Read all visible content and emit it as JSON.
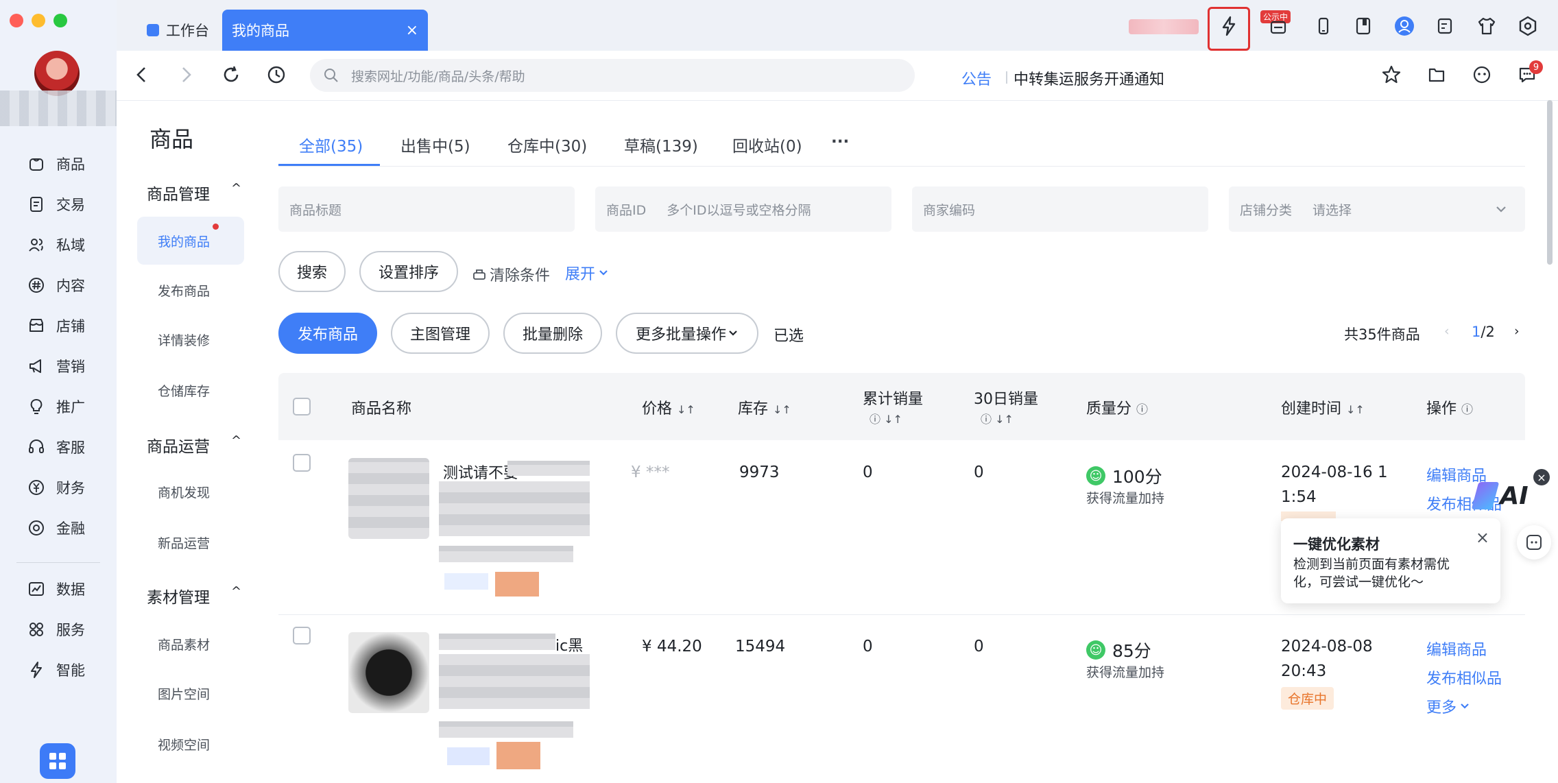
{
  "window": {
    "tabs": [
      {
        "label": "工作台",
        "active": false
      },
      {
        "label": "我的商品",
        "active": true,
        "close": "×"
      }
    ],
    "badge_gongshi": "公示中"
  },
  "toolbar": {
    "search_placeholder": "搜索网址/功能/商品/头条/帮助",
    "notice_tag": "公告",
    "notice_text": "中转集运服务开通通知",
    "message_count": "9"
  },
  "nav": [
    {
      "label": "商品",
      "icon": "product-icon"
    },
    {
      "label": "交易",
      "icon": "order-icon"
    },
    {
      "label": "私域",
      "icon": "users-icon"
    },
    {
      "label": "内容",
      "icon": "hashtag-icon"
    },
    {
      "label": "店铺",
      "icon": "store-icon"
    },
    {
      "label": "营销",
      "icon": "megaphone-icon"
    },
    {
      "label": "推广",
      "icon": "bulb-icon"
    },
    {
      "label": "客服",
      "icon": "headset-icon"
    },
    {
      "label": "财务",
      "icon": "yen-icon"
    },
    {
      "label": "金融",
      "icon": "finance-icon"
    },
    {
      "label": "数据",
      "icon": "chart-icon"
    },
    {
      "label": "服务",
      "icon": "grid-icon"
    },
    {
      "label": "智能",
      "icon": "lightning-icon"
    }
  ],
  "subnav": {
    "title": "商品",
    "groups": [
      {
        "label": "商品管理",
        "items": [
          "我的商品",
          "发布商品",
          "详情装修",
          "仓储库存"
        ]
      },
      {
        "label": "商品运营",
        "items": [
          "商机发现",
          "新品运营"
        ]
      },
      {
        "label": "素材管理",
        "items": [
          "商品素材",
          "图片空间",
          "视频空间"
        ]
      }
    ],
    "caret": "^"
  },
  "product_tabs": [
    "全部(35)",
    "出售中(5)",
    "仓库中(30)",
    "草稿(139)",
    "回收站(0)",
    "···"
  ],
  "filters": {
    "title_ph": "商品标题",
    "id_label": "商品ID",
    "id_ph": "多个ID以逗号或空格分隔",
    "code_ph": "商家编码",
    "cat_label": "店铺分类",
    "cat_ph": "请选择"
  },
  "actions": {
    "search": "搜索",
    "sort": "设置排序",
    "clear": "清除条件",
    "expand": "展开",
    "publish": "发布商品",
    "main_img": "主图管理",
    "batch_delete": "批量删除",
    "more_batch": "更多批量操作",
    "selected": "已选",
    "total": "共35件商品",
    "page_current": "1",
    "page_total": "/2"
  },
  "table": {
    "headers": [
      "商品名称",
      "价格",
      "库存",
      "累计销量",
      "30日销量",
      "质量分",
      "创建时间",
      "操作"
    ],
    "rows": [
      {
        "title": "测试请不要",
        "price": "¥ ***",
        "stock": "9973",
        "total_sales": "0",
        "sales_30": "0",
        "score": "100分",
        "score_sub": "获得流量加持",
        "time": "2024-08-16 1",
        "time2": "1:54",
        "op1": "编辑商品",
        "op2": "发布相似品"
      },
      {
        "title": "ic黑",
        "price": "¥ 44.20",
        "stock": "15494",
        "total_sales": "0",
        "sales_30": "0",
        "score": "85分",
        "score_sub": "获得流量加持",
        "time": "2024-08-08",
        "time2": "20:43",
        "status": "仓库中",
        "op1": "编辑商品",
        "op2": "发布相似品",
        "op3": "更多"
      }
    ]
  },
  "popup": {
    "title": "一键优化素材",
    "desc": "检测到当前页面有素材需优化，可尝试一键优化～",
    "close": "×"
  },
  "ai_badge": "AI"
}
